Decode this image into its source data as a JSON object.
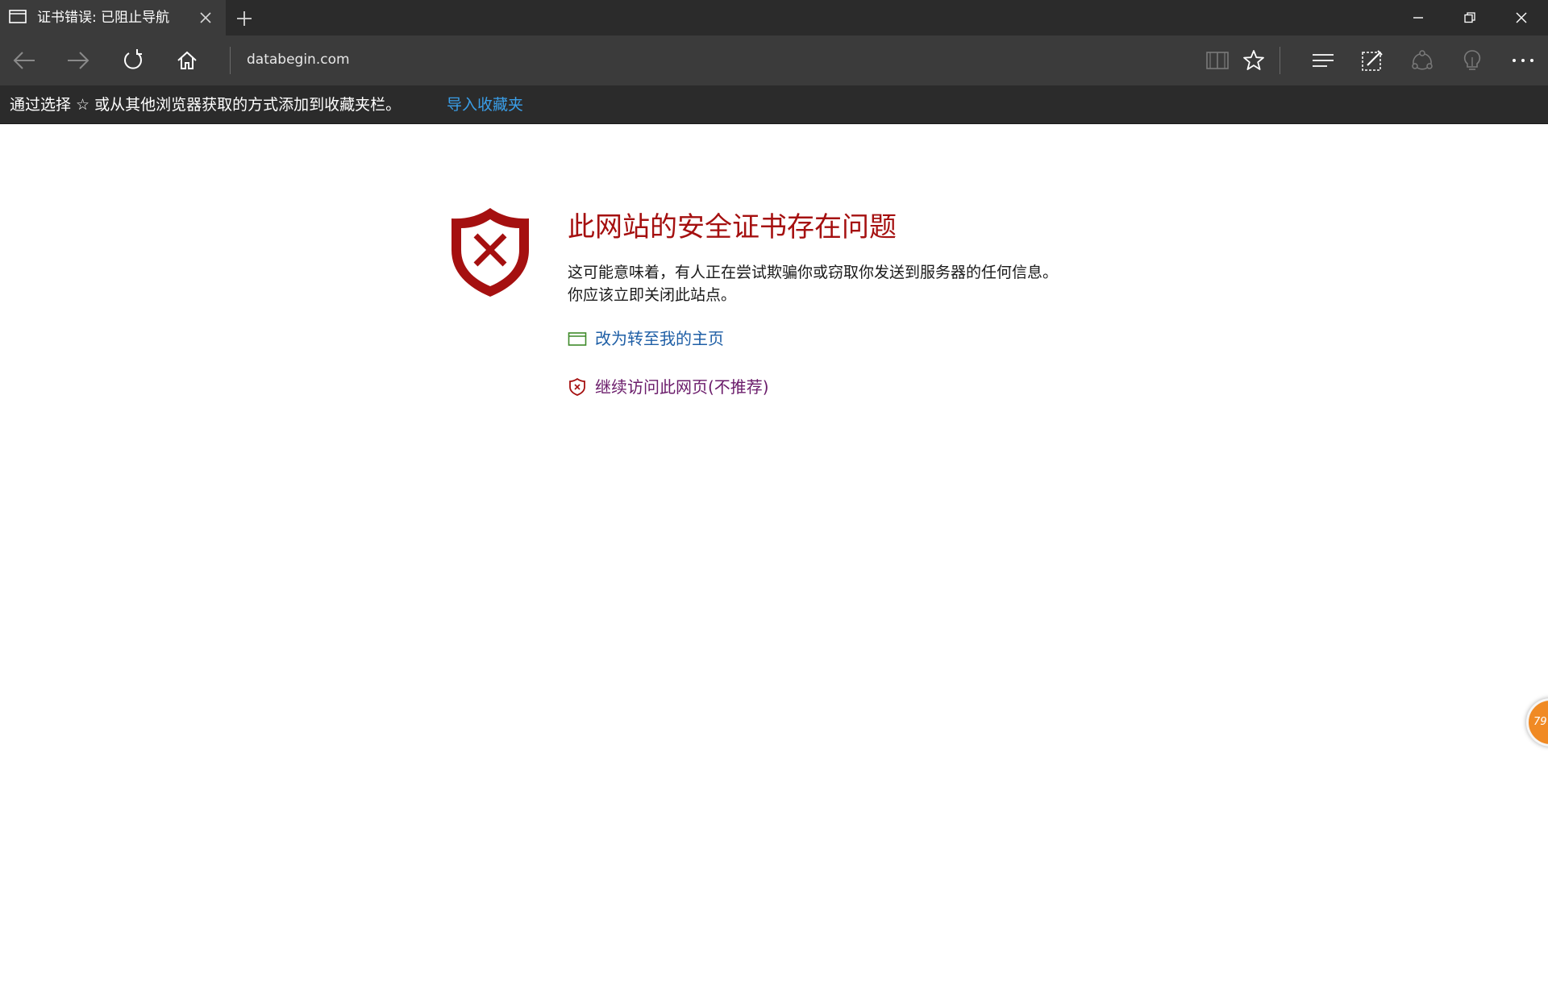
{
  "tab": {
    "title": "证书错误: 已阻止导航",
    "icon": "tab-page-icon"
  },
  "address_bar": {
    "url": "databegin.com"
  },
  "favorites_bar": {
    "message": "通过选择 ☆ 或从其他浏览器获取的方式添加到收藏夹栏。",
    "import_link": "导入收藏夹"
  },
  "error": {
    "title": "此网站的安全证书存在问题",
    "description_line1": "这可能意味着，有人正在尝试欺骗你或窃取你发送到服务器的任何信息。",
    "description_line2": "你应该立即关闭此站点。",
    "go_home_label": "改为转至我的主页",
    "continue_label": "继续访问此网页(不推荐)"
  },
  "floating_badge": {
    "text": "79"
  },
  "colors": {
    "chrome_dark": "#2b2b2b",
    "chrome_mid": "#3b3b3b",
    "error_red": "#a51010",
    "link_blue": "#1f5fa6",
    "link_visited": "#6a1b6a",
    "favbar_link": "#3a9ee8",
    "badge_orange": "#f08a24"
  }
}
